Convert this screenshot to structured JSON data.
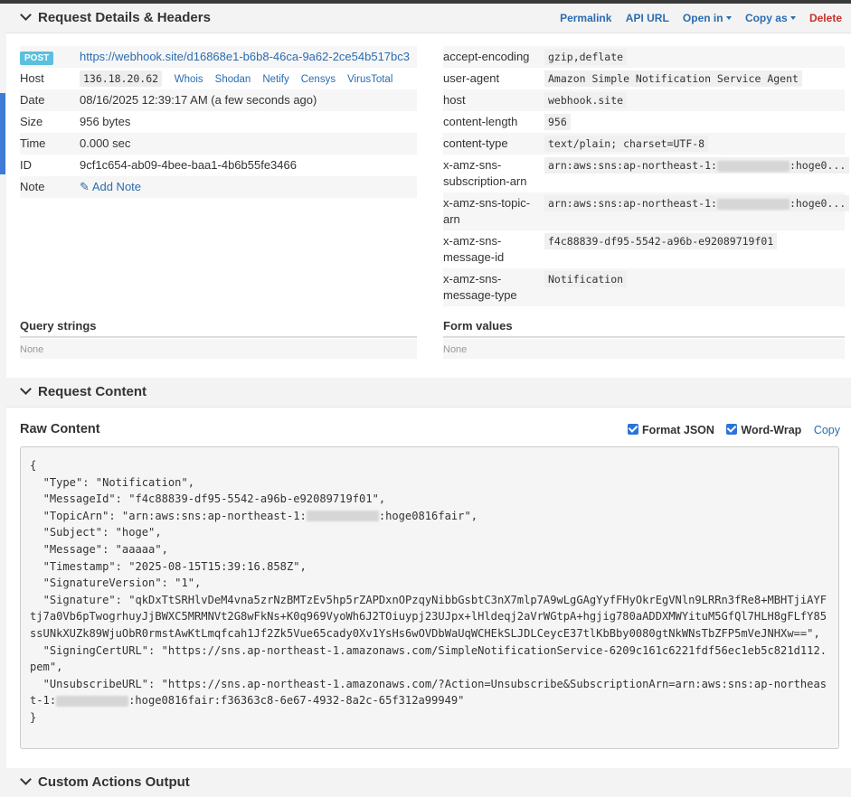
{
  "header": {
    "title": "Request Details & Headers",
    "actions": {
      "permalink": "Permalink",
      "api_url": "API URL",
      "open_in": "Open in",
      "copy_as": "Copy as",
      "delete": "Delete"
    }
  },
  "request": {
    "method": "POST",
    "url": "https://webhook.site/d16868e1-b6b8-46ca-9a62-2ce54b517bc3",
    "host_label": "Host",
    "host": "136.18.20.62",
    "host_links": [
      "Whois",
      "Shodan",
      "Netify",
      "Censys",
      "VirusTotal"
    ],
    "date_label": "Date",
    "date": "08/16/2025 12:39:17 AM (a few seconds ago)",
    "size_label": "Size",
    "size": "956 bytes",
    "time_label": "Time",
    "time": "0.000 sec",
    "id_label": "ID",
    "id": "9cf1c654-ab09-4bee-baa1-4b6b55fe3466",
    "note_label": "Note",
    "add_note": "Add Note"
  },
  "headers": [
    {
      "name": "accept-encoding",
      "value": "gzip,deflate"
    },
    {
      "name": "user-agent",
      "value": "Amazon Simple Notification Service Agent"
    },
    {
      "name": "host",
      "value": "webhook.site"
    },
    {
      "name": "content-length",
      "value": "956"
    },
    {
      "name": "content-type",
      "value": "text/plain; charset=UTF-8"
    },
    {
      "name": "x-amz-sns-subscription-arn",
      "value_prefix": "arn:aws:sns:ap-northeast-1:",
      "value_suffix": ":hoge0..."
    },
    {
      "name": "x-amz-sns-topic-arn",
      "value_prefix": "arn:aws:sns:ap-northeast-1:",
      "value_suffix": ":hoge0..."
    },
    {
      "name": "x-amz-sns-message-id",
      "value": "f4c88839-df95-5542-a96b-e92089719f01"
    },
    {
      "name": "x-amz-sns-message-type",
      "value": "Notification"
    }
  ],
  "query": {
    "title": "Query strings",
    "empty": "None"
  },
  "form": {
    "title": "Form values",
    "empty": "None"
  },
  "content_section": {
    "title": "Request Content"
  },
  "raw": {
    "title": "Raw Content",
    "format_json": "Format JSON",
    "word_wrap": "Word-Wrap",
    "copy": "Copy",
    "l01": "{",
    "l02": "  \"Type\": \"Notification\",",
    "l03": "  \"MessageId\": \"f4c88839-df95-5542-a96b-e92089719f01\",",
    "l04a": "  \"TopicArn\": \"arn:aws:sns:ap-northeast-1:",
    "l04b": ":hoge0816fair\",",
    "l05": "  \"Subject\": \"hoge\",",
    "l06": "  \"Message\": \"aaaaa\",",
    "l07": "  \"Timestamp\": \"2025-08-15T15:39:16.858Z\",",
    "l08": "  \"SignatureVersion\": \"1\",",
    "l09": "  \"Signature\": \"qkDxTtSRHlvDeM4vna5zrNzBMTzEv5hp5rZAPDxnOPzqyNibbGsbtC3nX7mlp7A9wLgGAgYyfFHyOkrEgVNln9LRRn3fRe8+MBHTjiAYFtj7a0Vb6pTwogrhuyJjBWXC5MRMNVt2G8wFkNs+K0q969VyoWh6J2TOiuypj23UJpx+lHldeqj2aVrWGtpA+hgjig780aADDXMWYituM5GfQl7HLH8gFLfY85ssUNkXUZk89WjuObR0rmstAwKtLmqfcah1Jf2Zk5Vue65cady0Xv1YsHs6wOVDbWaUqWCHEkSLJDLCeycE37tlKbBby0080gtNkWNsTbZFP5mVeJNHXw==\",",
    "l10": "  \"SigningCertURL\": \"https://sns.ap-northeast-1.amazonaws.com/SimpleNotificationService-6209c161c6221fdf56ec1eb5c821d112.pem\",",
    "l11a": "  \"UnsubscribeURL\": \"https://sns.ap-northeast-1.amazonaws.com/?Action=Unsubscribe&SubscriptionArn=arn:aws:sns:ap-northeast-1:",
    "l11b": ":hoge0816fair:f36363c8-6e67-4932-8a2c-65f312a99949\"",
    "l12": "}"
  },
  "custom_section": {
    "title": "Custom Actions Output"
  }
}
